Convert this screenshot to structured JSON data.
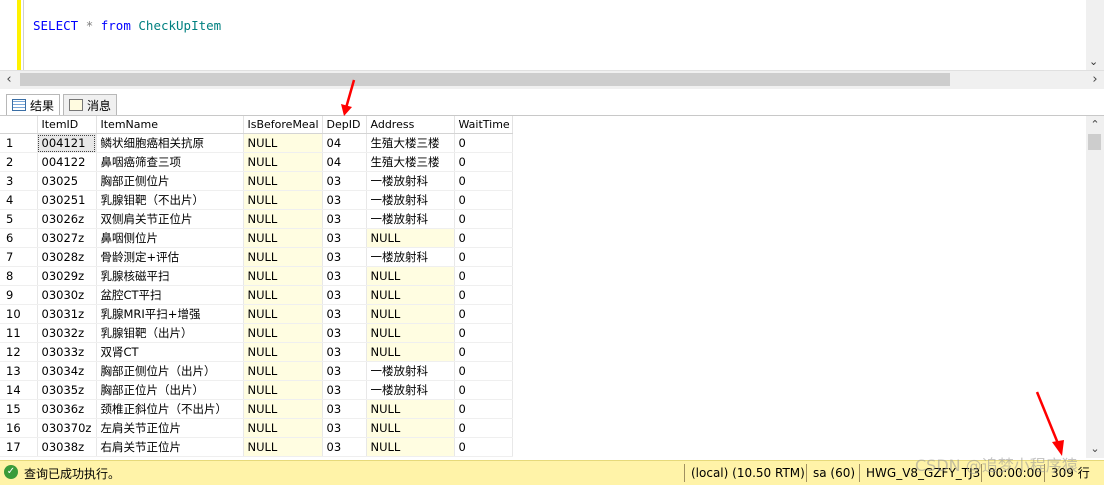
{
  "editor": {
    "sql_keyword_select": "SELECT",
    "sql_star": "*",
    "sql_keyword_from": "from",
    "sql_table": "CheckUpItem"
  },
  "tabs": [
    {
      "label": "结果",
      "icon": "grid-icon"
    },
    {
      "label": "消息",
      "icon": "message-icon"
    }
  ],
  "grid": {
    "columns": [
      "",
      "ItemID",
      "ItemName",
      "IsBeforeMeal",
      "DepID",
      "Address",
      "WaitTime"
    ],
    "rows": [
      [
        "1",
        "004121",
        "鳞状细胞癌相关抗原",
        "NULL",
        "04",
        "生殖大楼三楼",
        "0"
      ],
      [
        "2",
        "004122",
        "鼻咽癌筛查三项",
        "NULL",
        "04",
        "生殖大楼三楼",
        "0"
      ],
      [
        "3",
        "03025",
        "胸部正侧位片",
        "NULL",
        "03",
        "一楼放射科",
        "0"
      ],
      [
        "4",
        "030251",
        "乳腺钼靶（不出片）",
        "NULL",
        "03",
        "一楼放射科",
        "0"
      ],
      [
        "5",
        "03026z",
        "双侧肩关节正位片",
        "NULL",
        "03",
        "一楼放射科",
        "0"
      ],
      [
        "6",
        "03027z",
        "鼻咽侧位片",
        "NULL",
        "03",
        "NULL",
        "0"
      ],
      [
        "7",
        "03028z",
        "骨龄测定+评估",
        "NULL",
        "03",
        "一楼放射科",
        "0"
      ],
      [
        "8",
        "03029z",
        "乳腺核磁平扫",
        "NULL",
        "03",
        "NULL",
        "0"
      ],
      [
        "9",
        "03030z",
        "盆腔CT平扫",
        "NULL",
        "03",
        "NULL",
        "0"
      ],
      [
        "10",
        "03031z",
        "乳腺MRI平扫+增强",
        "NULL",
        "03",
        "NULL",
        "0"
      ],
      [
        "11",
        "03032z",
        "乳腺钼靶（出片）",
        "NULL",
        "03",
        "NULL",
        "0"
      ],
      [
        "12",
        "03033z",
        "双肾CT",
        "NULL",
        "03",
        "NULL",
        "0"
      ],
      [
        "13",
        "03034z",
        "胸部正侧位片（出片）",
        "NULL",
        "03",
        "一楼放射科",
        "0"
      ],
      [
        "14",
        "03035z",
        "胸部正位片（出片）",
        "NULL",
        "03",
        "一楼放射科",
        "0"
      ],
      [
        "15",
        "03036z",
        "颈椎正斜位片（不出片）",
        "NULL",
        "03",
        "NULL",
        "0"
      ],
      [
        "16",
        "030370z",
        "左肩关节正位片",
        "NULL",
        "03",
        "NULL",
        "0"
      ],
      [
        "17",
        "03038z",
        "右肩关节正位片",
        "NULL",
        "03",
        "NULL",
        "0"
      ]
    ]
  },
  "status": {
    "message": "查询已成功执行。",
    "server": "(local) (10.50 RTM)",
    "user": "sa (60)",
    "database": "HWG_V8_GZFY_TJ3",
    "elapsed": "00:00:00",
    "row_count": "309 行"
  },
  "watermark": "CSDN @追梦小程序猿",
  "colors": {
    "status_bar": "#fff3a8",
    "null_cell": "#fffde1",
    "annotation_arrow": "#ff0000",
    "keyword": "#0000ff",
    "identifier": "#008080"
  }
}
